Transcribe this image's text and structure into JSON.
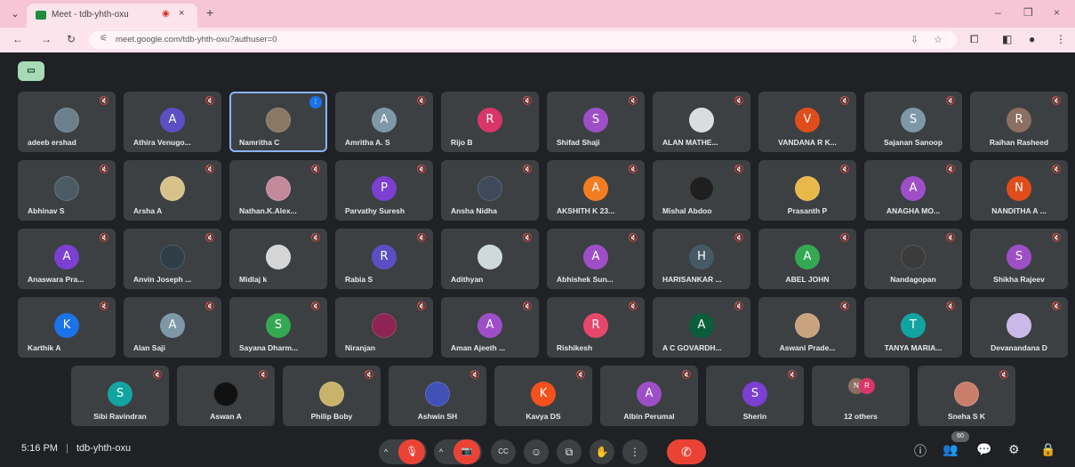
{
  "browser": {
    "tab_title": "Meet - tdb-yhth-oxu",
    "tab_close": "×",
    "new_tab": "+",
    "window_minimize": "–",
    "window_restore": "❐",
    "window_close": "×",
    "url": "meet.google.com/tdb-yhth-oxu?authuser=0"
  },
  "colors": {
    "accent": "#8ab4f8",
    "end_call": "#ea4335",
    "tile_bg": "#3c4043",
    "page_bg": "#202124",
    "tab_strip": "#f7c6d6"
  },
  "tiles_row1": [
    {
      "name": "adeeb ershad",
      "initial": "",
      "color": "#6d7f8a",
      "photo": true
    },
    {
      "name": "Athira Venugo...",
      "initial": "A",
      "color": "#5c4fc4",
      "photo": false
    },
    {
      "name": "Namritha C",
      "initial": "",
      "color": "#8a7764",
      "photo": true
    },
    {
      "name": "Amritha A. S",
      "initial": "A",
      "color": "#7e98a7",
      "photo": false
    },
    {
      "name": "Rijo B",
      "initial": "R",
      "color": "#d93568",
      "photo": false
    },
    {
      "name": "Shifad Shaji",
      "initial": "S",
      "color": "#9e4fc7",
      "photo": false
    },
    {
      "name": "ALAN MATHE...",
      "initial": "",
      "color": "#dadce0",
      "photo": true
    },
    {
      "name": "VANDANA R K...",
      "initial": "V",
      "color": "#e04d1b",
      "photo": false
    },
    {
      "name": "Sajanan Sanoop",
      "initial": "S",
      "color": "#7e98a7",
      "photo": false
    },
    {
      "name": "Raihan Rasheed",
      "initial": "R",
      "color": "#8d6e63",
      "photo": false
    }
  ],
  "tiles_row2": [
    {
      "name": "Abhinav S",
      "initial": "",
      "color": "#4a5b64",
      "photo": true
    },
    {
      "name": "Arsha A",
      "initial": "",
      "color": "#d7c28a",
      "photo": true
    },
    {
      "name": "Nathan.K.Alex...",
      "initial": "",
      "color": "#c2899a",
      "photo": true
    },
    {
      "name": "Parvathy Suresh",
      "initial": "P",
      "color": "#7b3fd1",
      "photo": false
    },
    {
      "name": "Ansha Nidha",
      "initial": "",
      "color": "#3e4a59",
      "photo": true
    },
    {
      "name": "AKSHITH K 23...",
      "initial": "A",
      "color": "#f27d21",
      "photo": false
    },
    {
      "name": "Mishal Abdoo",
      "initial": "",
      "color": "#1f1f1f",
      "photo": true
    },
    {
      "name": "Prasanth P",
      "initial": "",
      "color": "#e8b84a",
      "photo": true
    },
    {
      "name": "ANAGHA MO...",
      "initial": "A",
      "color": "#9e4fc7",
      "photo": false
    },
    {
      "name": "NANDITHA A ...",
      "initial": "N",
      "color": "#e04d1b",
      "photo": false
    }
  ],
  "tiles_row3": [
    {
      "name": "Anaswara Pra...",
      "initial": "A",
      "color": "#7b3fd1",
      "photo": false
    },
    {
      "name": "Anvin Joseph ...",
      "initial": "",
      "color": "#2f3e46",
      "photo": true
    },
    {
      "name": "Midlaj k",
      "initial": "",
      "color": "#d5d5d5",
      "photo": true
    },
    {
      "name": "Rabia S",
      "initial": "R",
      "color": "#5c4fc4",
      "photo": false
    },
    {
      "name": "Adithyan",
      "initial": "",
      "color": "#cfd8dc",
      "photo": true
    },
    {
      "name": "Abhishek Sun...",
      "initial": "A",
      "color": "#9e4fc7",
      "photo": false
    },
    {
      "name": "HARISANKAR ...",
      "initial": "H",
      "color": "#455a64",
      "photo": false
    },
    {
      "name": "ABEL JOHN",
      "initial": "A",
      "color": "#34a853",
      "photo": false
    },
    {
      "name": "Nandagopan",
      "initial": "",
      "color": "#3b3b3b",
      "photo": true
    },
    {
      "name": "Shikha Rajeev",
      "initial": "S",
      "color": "#9e4fc7",
      "photo": false
    }
  ],
  "tiles_row4": [
    {
      "name": "Karthik A",
      "initial": "K",
      "color": "#1a73e8",
      "photo": false
    },
    {
      "name": "Alan Saji",
      "initial": "A",
      "color": "#7e98a7",
      "photo": false
    },
    {
      "name": "Sayana Dharm...",
      "initial": "S",
      "color": "#34a853",
      "photo": false
    },
    {
      "name": "Niranjan",
      "initial": "",
      "color": "#8e2451",
      "photo": true
    },
    {
      "name": "Aman Ajeeth ...",
      "initial": "A",
      "color": "#9e4fc7",
      "photo": false
    },
    {
      "name": "Rishikesh",
      "initial": "R",
      "color": "#e8476c",
      "photo": false
    },
    {
      "name": "A C GOVARDH...",
      "initial": "A",
      "color": "#0b5e3b",
      "photo": false
    },
    {
      "name": "Aswani Prade...",
      "initial": "",
      "color": "#c9a27e",
      "photo": true
    },
    {
      "name": "TANYA MARIA...",
      "initial": "T",
      "color": "#12a4a0",
      "photo": false
    },
    {
      "name": "Devanandana D",
      "initial": "",
      "color": "#c9b8e8",
      "photo": true
    }
  ],
  "tiles_row5": [
    {
      "name": "Sibi Ravindran",
      "initial": "S",
      "color": "#12a4a0",
      "photo": false
    },
    {
      "name": "Aswan A",
      "initial": "",
      "color": "#111111",
      "photo": true
    },
    {
      "name": "Philip Boby",
      "initial": "",
      "color": "#c9b26a",
      "photo": true
    },
    {
      "name": "Ashwin SH",
      "initial": "",
      "color": "#3f51b5",
      "photo": true
    },
    {
      "name": "Kavya DS",
      "initial": "K",
      "color": "#f4511e",
      "photo": false
    },
    {
      "name": "Albin Perumal",
      "initial": "A",
      "color": "#9e4fc7",
      "photo": false
    },
    {
      "name": "Sherin",
      "initial": "S",
      "color": "#7b3fd1",
      "photo": false
    },
    {
      "name": "12 others",
      "initial": "",
      "color": "#3c4043",
      "photo": false
    },
    {
      "name": "Sneha S K",
      "initial": "",
      "color": "#c97e6b",
      "photo": true
    }
  ],
  "others_bubbles": [
    "N",
    "R"
  ],
  "bottom": {
    "time": "5:16 PM",
    "separator": "|",
    "meeting_code": "tdb-yhth-oxu",
    "people_count": "60",
    "chevron": "^",
    "mic_off": "🎙",
    "cam_off": "📷",
    "cc": "CC",
    "emoji": "☺",
    "present": "⧉",
    "hand": "✋",
    "more": "⋮",
    "end_call": "✆",
    "info": "ⓘ",
    "people": "👥",
    "chat": "💬",
    "activities": "⚙",
    "host_controls": "🔒"
  }
}
